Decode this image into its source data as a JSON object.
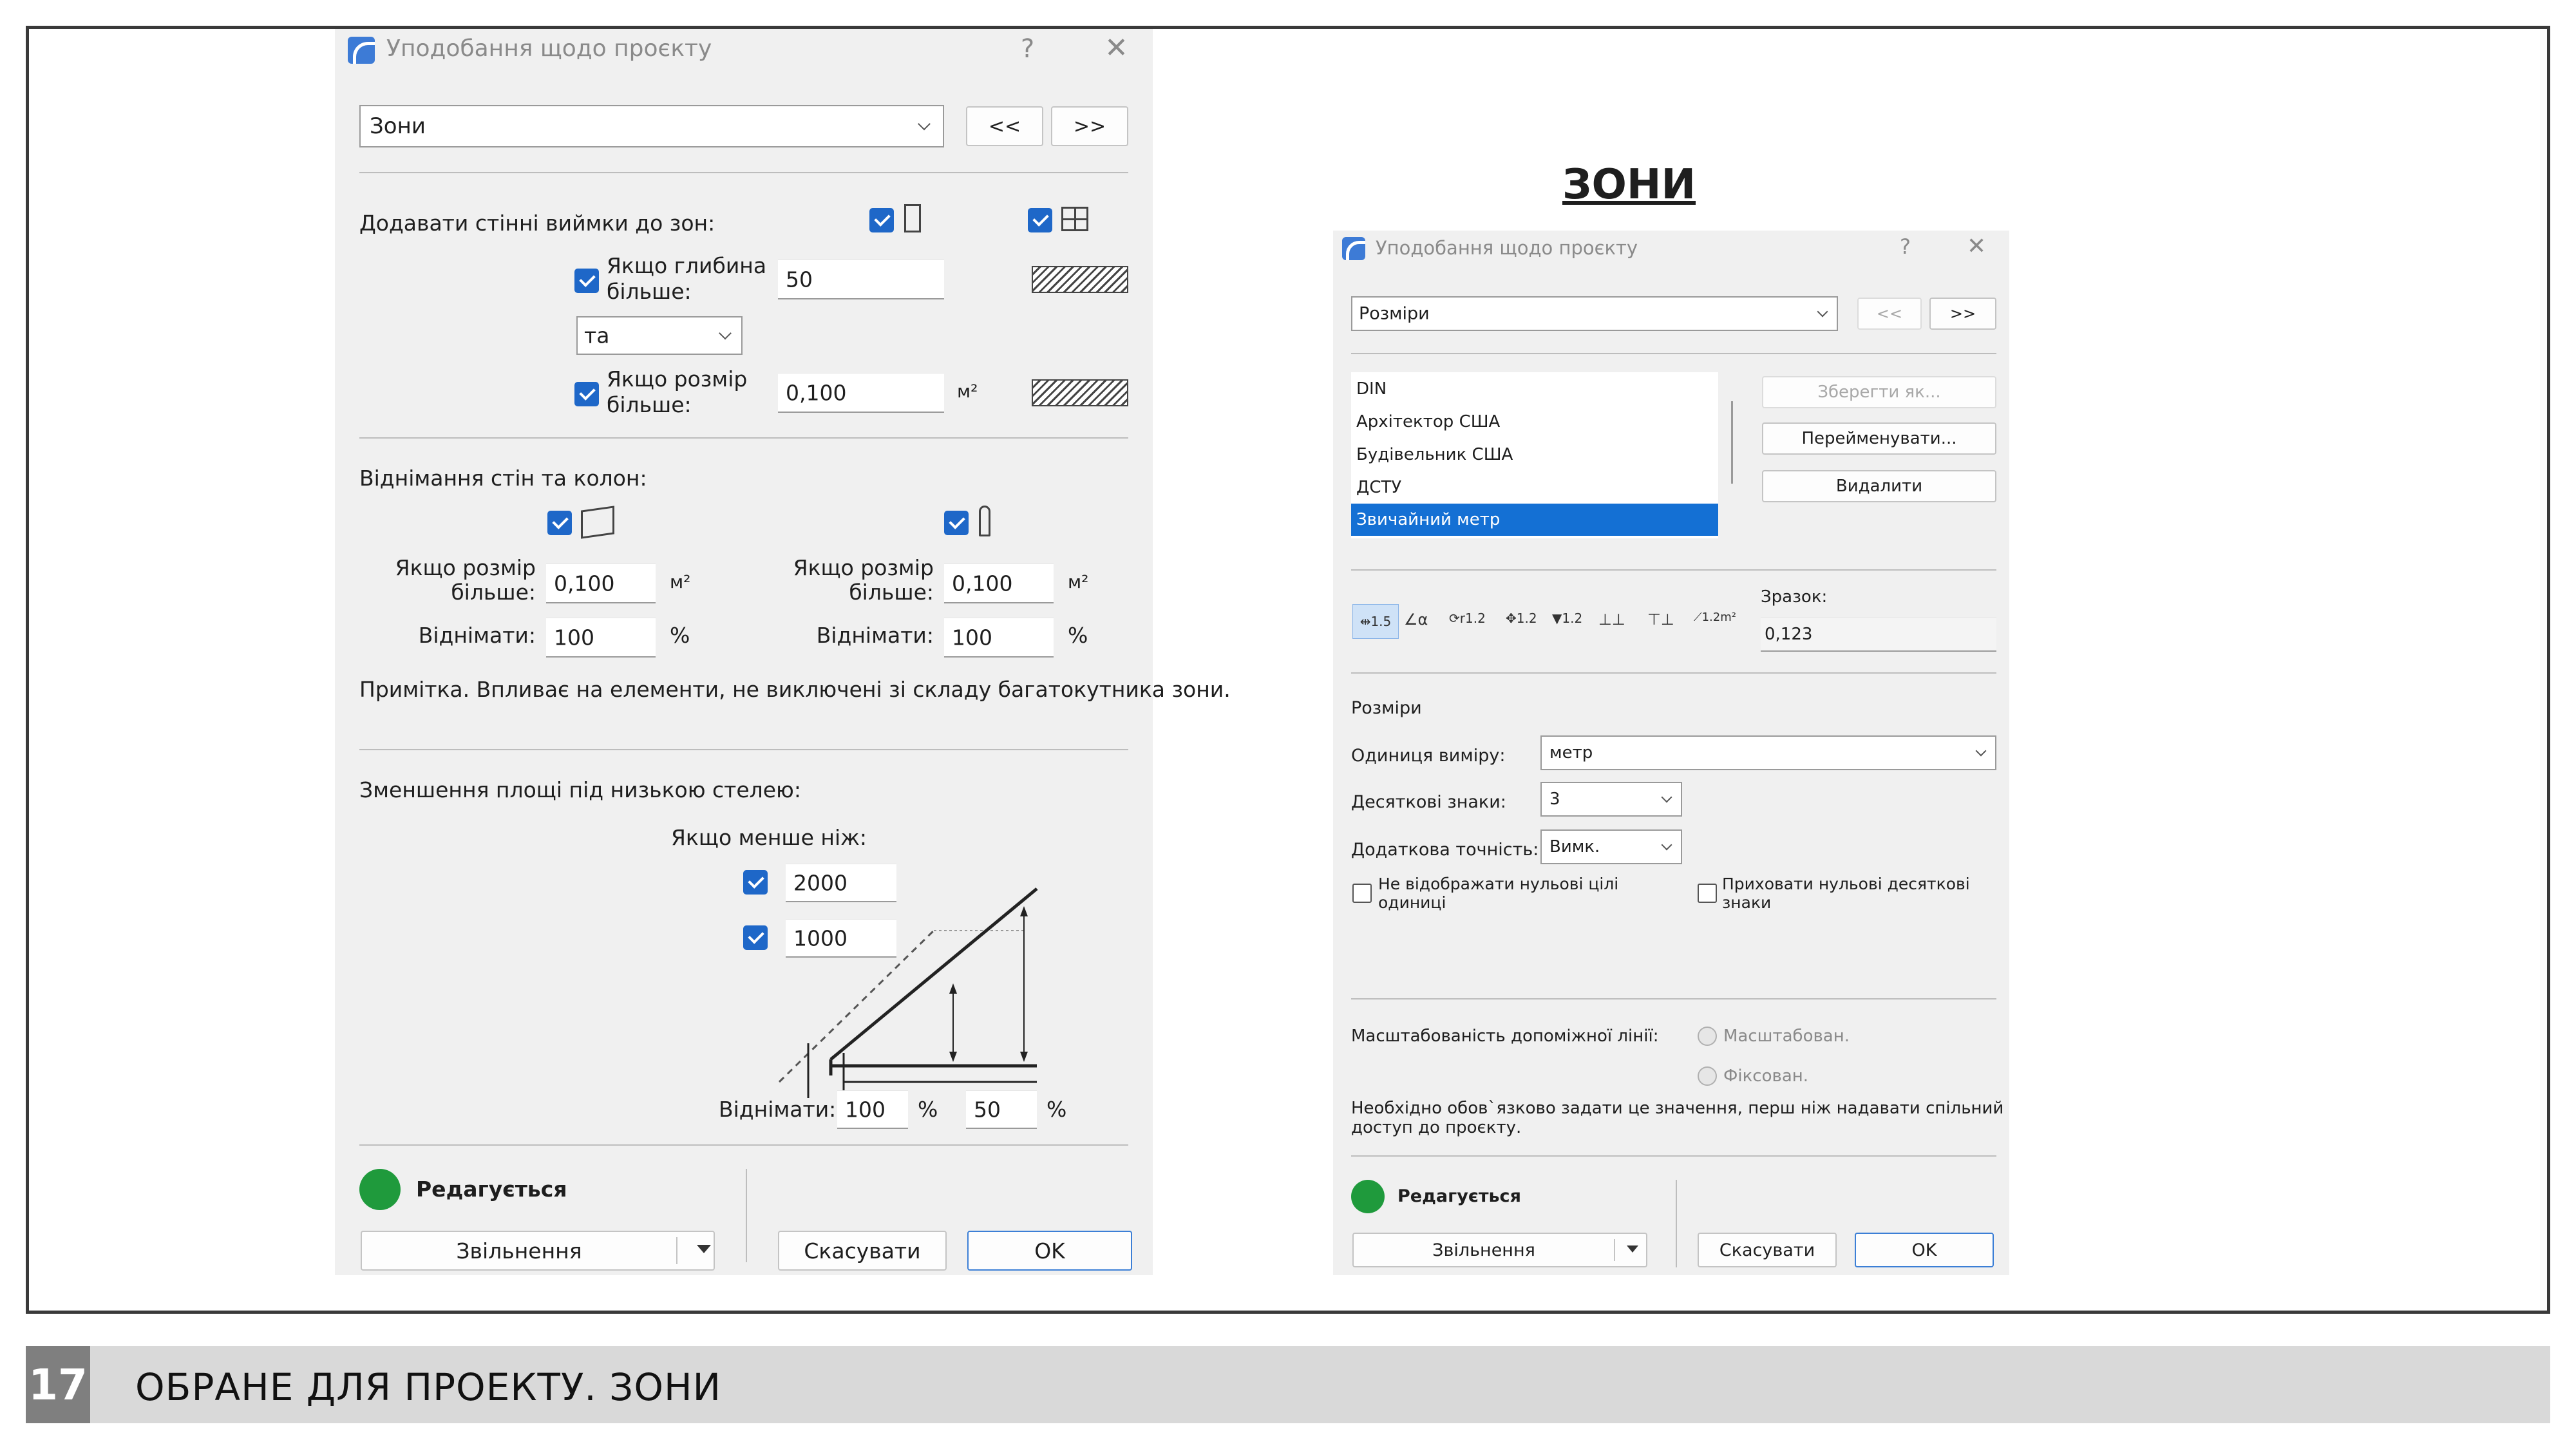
{
  "slide": {
    "heading": "ЗОНИ",
    "footer_number": "17",
    "footer_text": "ОБРАНЕ ДЛЯ ПРОЕКТУ. ЗОНИ"
  },
  "left": {
    "title": "Уподобання щодо проєкту",
    "help": "?",
    "close": "✕",
    "category": "Зони",
    "prev": "<<",
    "next": ">>",
    "add_niches_label": "Додавати стінні виймки до зон:",
    "depth_label_1": "Якщо глибина",
    "depth_label_2": "більше:",
    "depth_value": "50",
    "combine_value": "та",
    "size_label_1": "Якщо розмір",
    "size_label_2": "більше:",
    "size_value": "0,100",
    "unit_m2": "м²",
    "subtract_label": "Віднімання стін та колон:",
    "wall_size_label_1": "Якщо розмір",
    "wall_size_label_2": "більше:",
    "wall_size_value": "0,100",
    "wall_subtract_label": "Віднімати:",
    "wall_subtract_value": "100",
    "col_size_label_1": "Якщо розмір",
    "col_size_label_2": "більше:",
    "col_size_value": "0,100",
    "col_subtract_label": "Віднімати:",
    "col_subtract_value": "100",
    "percent": "%",
    "note": "Примітка. Впливає на елементи, не виключені зі складу багатокутника зони.",
    "low_ceiling_label": "Зменшення площі під низькою стелею:",
    "less_than_label": "Якщо менше ніж:",
    "h1_value": "2000",
    "h2_value": "1000",
    "reduce_label": "Віднімати:",
    "reduce_1": "100",
    "reduce_2": "50",
    "status": "Редагується",
    "release": "Звільнення",
    "cancel": "Скасувати",
    "ok": "OK"
  },
  "right": {
    "title": "Уподобання щодо проєкту",
    "help": "?",
    "close": "✕",
    "category": "Розміри",
    "prev": "<<",
    "next": ">>",
    "list": [
      "DIN",
      "Архітектор США",
      "Будівельник США",
      "ДСТУ",
      "Звичайний метр"
    ],
    "save_as": "Зберегти як...",
    "rename": "Перейменувати...",
    "delete": "Видалити",
    "icons": [
      "⇹1.5",
      "∠α",
      "⟳r1.2",
      "✥1.2",
      "▼1.2",
      "⊥⊥",
      "⊤⊥",
      "⟋1.2m²"
    ],
    "sample_label": "Зразок:",
    "sample_value": "0,123",
    "section": "Розміри",
    "unit_label": "Одиниця виміру:",
    "unit_value": "метр",
    "decimals_label": "Десяткові знаки:",
    "decimals_value": "3",
    "extra_label": "Додаткова точність:",
    "extra_value": "Вимк.",
    "hide_zero_int_1": "Не відображати нульові цілі",
    "hide_zero_int_2": "одиниці",
    "hide_zero_dec_1": "Приховати нульові десяткові",
    "hide_zero_dec_2": "знаки",
    "scalability_label": "Масштабованість допоміжної лінії:",
    "opt_scaled": "Масштабован.",
    "opt_fixed": "Фіксован.",
    "notice_1": "Необхідно обов`язково задати це значення, перш ніж надавати спільний",
    "notice_2": "доступ до проєкту.",
    "status": "Редагується",
    "release": "Звільнення",
    "cancel": "Скасувати",
    "ok": "OK"
  },
  "colors": {
    "accent": "#1470d4",
    "status_green": "#1f9a3c",
    "footer_gray": "#d9d9d9",
    "footer_num": "#7f7f7f"
  }
}
